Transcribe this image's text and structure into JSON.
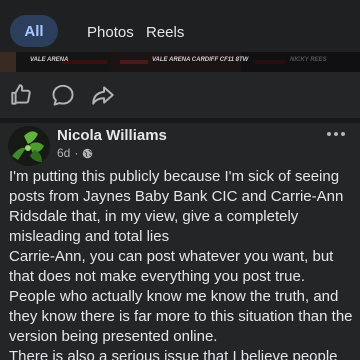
{
  "tabs": [
    {
      "label": "All",
      "active": true
    },
    {
      "label": "Photos",
      "active": false
    },
    {
      "label": "Reels",
      "active": false
    }
  ],
  "banner": {
    "left_text": "VALE ARENA",
    "mid_text": "VALE ARENA CARDIFF CF11 8TW",
    "right_text": "NICKY REES"
  },
  "actions": {
    "icons": [
      "like-icon",
      "comment-icon",
      "share-icon"
    ]
  },
  "post": {
    "author": "Nicola Williams",
    "time": "6d",
    "separator": "·",
    "audience_icon": "globe-icon",
    "paragraphs": [
      "I'm putting this publicly because I'm sick of seeing posts from Jaynes Baby Bank CIC and Carrie-Ann Ridsdale that, in my view, give a completely misleading and total lies",
      "Carrie-Ann, you can post whatever you want, but that does not make everything you post true.",
      "People who actually know me know the truth, and they know there is far more to this situation than the version being presented online.",
      "There is also a serious issue that I believe people"
    ]
  },
  "colors": {
    "background": "#242526",
    "active_tab_bg": "#2b3f5c",
    "active_tab_text": "#a7c8ff",
    "text": "#e4e6eb",
    "secondary": "#b0b3b8"
  }
}
